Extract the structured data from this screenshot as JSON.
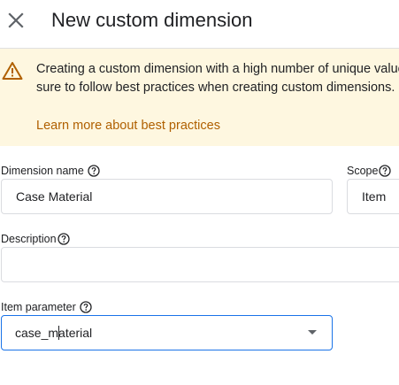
{
  "dialog": {
    "title": "New custom dimension",
    "close_icon": "close-icon"
  },
  "banner": {
    "icon": "warning-icon",
    "line1": "Creating a custom dimension with a high number of unique values",
    "line2": "sure to follow best practices when creating custom dimensions.",
    "link": "Learn more about best practices"
  },
  "form": {
    "dimension_name": {
      "label": "Dimension name",
      "value": "Case Material"
    },
    "scope": {
      "label": "Scope",
      "value": "Item"
    },
    "description": {
      "label": "Description",
      "value": ""
    },
    "item_parameter": {
      "label": "Item parameter",
      "value_before_cursor": "case_m",
      "value_after_cursor": "aterial"
    }
  },
  "colors": {
    "banner_bg": "#fef7e0",
    "link": "#b06000",
    "focus": "#1a73e8",
    "warning_icon": "#b06000"
  }
}
